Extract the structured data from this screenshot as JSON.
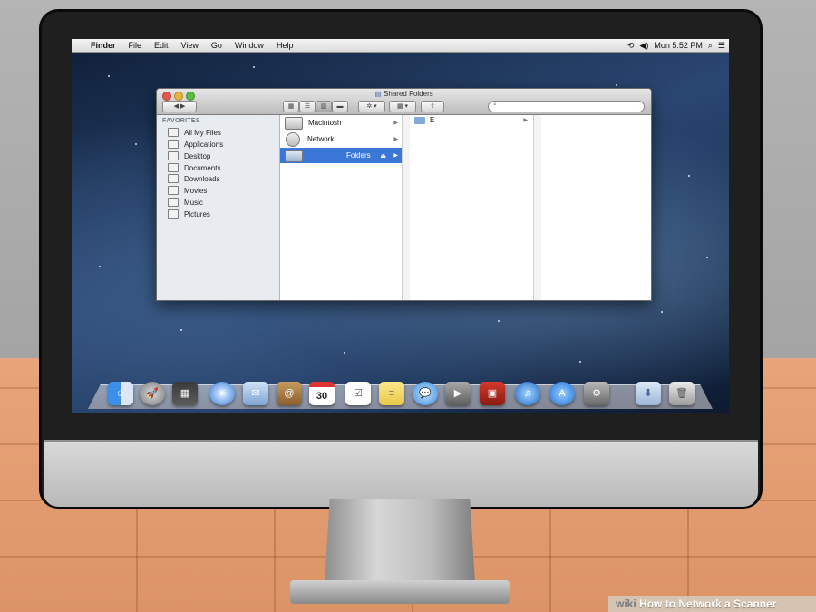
{
  "menubar": {
    "apple": "",
    "items": [
      "Finder",
      "File",
      "Edit",
      "View",
      "Go",
      "Window",
      "Help"
    ],
    "clock": "Mon 5:52 PM"
  },
  "finder": {
    "title": "Shared Folders",
    "sidebar_heading": "FAVORITES",
    "sidebar_items": [
      "All My Files",
      "Applications",
      "Desktop",
      "Documents",
      "Downloads",
      "Movies",
      "Music",
      "Pictures"
    ],
    "column1": [
      "Macintosh",
      "Network",
      "Folders"
    ],
    "column2": [
      "E"
    ]
  },
  "dock": {
    "icons": [
      "finder-icon",
      "launchpad-icon",
      "mission-control-icon",
      "safari-icon",
      "mail-icon",
      "contacts-icon",
      "calendar-icon",
      "reminders-icon",
      "notes-icon",
      "messages-icon",
      "facetime-icon",
      "photo-booth-icon",
      "itunes-icon",
      "app-store-icon",
      "system-preferences-icon",
      "downloads-stack-icon",
      "trash-icon"
    ],
    "calendar_day": "30"
  },
  "caption": {
    "prefix": "wiki",
    "text": "How to Network a Scanner"
  }
}
